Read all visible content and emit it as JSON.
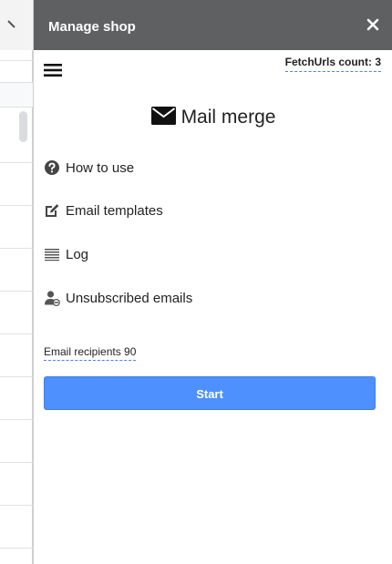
{
  "panel": {
    "title": "Manage shop",
    "fetch_count_label": "FetchUrls count: 3"
  },
  "app": {
    "title": "Mail merge"
  },
  "nav": {
    "items": [
      {
        "label": "How to use",
        "icon": "help-circle-icon"
      },
      {
        "label": "Email templates",
        "icon": "edit-square-icon"
      },
      {
        "label": "Log",
        "icon": "list-lines-icon"
      },
      {
        "label": "Unsubscribed emails",
        "icon": "user-blocked-icon"
      }
    ]
  },
  "recipients": {
    "label": "Email recipients 90"
  },
  "actions": {
    "start_label": "Start"
  },
  "colors": {
    "header_bg": "#5f6062",
    "accent": "#4d90fe",
    "dashed_underline": "#4a86e8"
  }
}
